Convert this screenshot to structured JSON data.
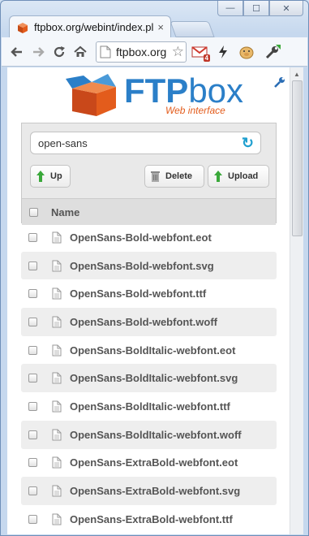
{
  "window": {
    "min": "—",
    "max": "☐",
    "close": "✕"
  },
  "tab": {
    "title": "ftpbox.org/webint/index.pl",
    "close": "×"
  },
  "toolbar": {
    "url": "ftpbox.org"
  },
  "logo": {
    "brand_ftp": "FTP",
    "brand_box": "box",
    "subtitle": "Web interface"
  },
  "path": {
    "value": "open-sans"
  },
  "buttons": {
    "up": "Up",
    "delete": "Delete",
    "upload": "Upload"
  },
  "table": {
    "header": "Name"
  },
  "files": [
    "OpenSans-Bold-webfont.eot",
    "OpenSans-Bold-webfont.svg",
    "OpenSans-Bold-webfont.ttf",
    "OpenSans-Bold-webfont.woff",
    "OpenSans-BoldItalic-webfont.eot",
    "OpenSans-BoldItalic-webfont.svg",
    "OpenSans-BoldItalic-webfont.ttf",
    "OpenSans-BoldItalic-webfont.woff",
    "OpenSans-ExtraBold-webfont.eot",
    "OpenSans-ExtraBold-webfont.svg",
    "OpenSans-ExtraBold-webfont.ttf"
  ],
  "extensions": {
    "mail_badge": "4"
  },
  "colors": {
    "accent": "#2b7fc8",
    "brand_orange": "#e35c1c",
    "up_arrow": "#3aa83a"
  }
}
